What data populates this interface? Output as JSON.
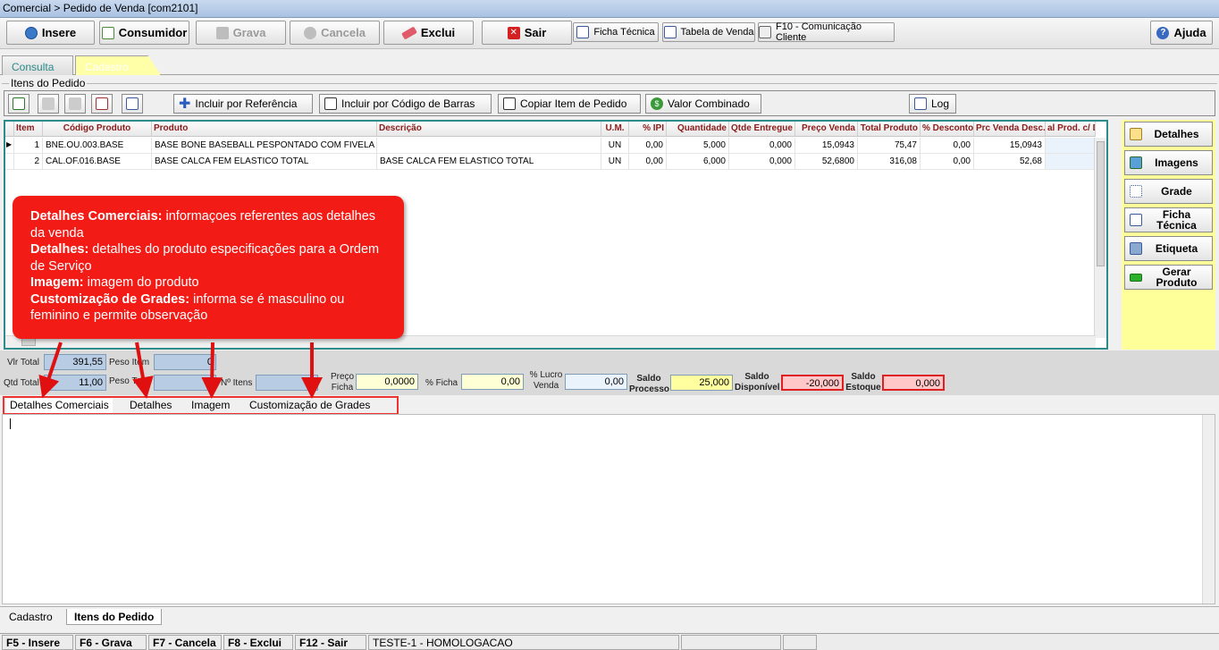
{
  "window": {
    "title": "Comercial > Pedido de Venda [com2101]"
  },
  "toolbar": {
    "insere": "Insere",
    "consumidor": "Consumidor",
    "grava": "Grava",
    "cancela": "Cancela",
    "exclui": "Exclui",
    "sair": "Sair",
    "ficha_tecnica": "Ficha Técnica",
    "tabela_venda": "Tabela de Venda",
    "comunicacao": "F10 - Comunicação Cliente",
    "ajuda": "Ajuda"
  },
  "main_tabs": {
    "consulta": "Consulta",
    "cadastro": "Cadastro"
  },
  "group": {
    "title": "Itens do Pedido"
  },
  "item_toolbar": {
    "incluir_ref": "Incluir por Referência",
    "incluir_barras": "Incluir por Código de Barras",
    "copiar": "Copiar Item de Pedido",
    "valor_combinado": "Valor Combinado",
    "log": "Log"
  },
  "grid": {
    "headers": [
      "Item",
      "Código Produto",
      "Produto",
      "Descrição",
      "U.M.",
      "% IPI",
      "Quantidade",
      "Qtde Entregue",
      "Preço Venda",
      "Total Produto",
      "% Desconto",
      "Prc Venda Desc.",
      "al Prod. c/ D"
    ],
    "rows": [
      {
        "item": "1",
        "codigo": "BNE.OU.003.BASE",
        "produto": "BASE BONE BASEBALL PESPONTADO COM FIVELA METALI",
        "descricao": "",
        "um": "UN",
        "ipi": "0,00",
        "quantidade": "5,000",
        "entregue": "0,000",
        "preco": "15,0943",
        "total": "75,47",
        "desconto": "0,00",
        "prc_desc": "15,0943"
      },
      {
        "item": "2",
        "codigo": "CAL.OF.016.BASE",
        "produto": "BASE CALCA FEM ELASTICO TOTAL",
        "descricao": "BASE CALCA FEM ELASTICO TOTAL",
        "um": "UN",
        "ipi": "0,00",
        "quantidade": "6,000",
        "entregue": "0,000",
        "preco": "52,6800",
        "total": "316,08",
        "desconto": "0,00",
        "prc_desc": "52,68"
      }
    ]
  },
  "side_buttons": {
    "detalhes": "Detalhes",
    "imagens": "Imagens",
    "grade": "Grade",
    "ficha_tecnica": "Ficha Técnica",
    "etiqueta": "Etiqueta",
    "gerar_produto": "Gerar Produto"
  },
  "totals": {
    "vlr_total_label": "Vlr Total",
    "vlr_total": "391,55",
    "qtd_total_label": "Qtd Total",
    "qtd_total": "11,00",
    "peso_item_label": "Peso Item",
    "peso_item": "0",
    "peso_total_label": "Peso Total",
    "peso_total": "",
    "n_itens_label": "Nº Itens",
    "n_itens": "",
    "preco_ficha_label": "Preço Ficha",
    "preco_ficha": "0,0000",
    "pct_ficha_label": "% Ficha",
    "pct_ficha": "0,00",
    "pct_lucro_label": "% Lucro Venda",
    "pct_lucro": "0,00",
    "saldo_processo_label": "Saldo Processo",
    "saldo_processo": "25,000",
    "saldo_disponivel_label": "Saldo Disponível",
    "saldo_disponivel": "-20,000",
    "saldo_estoque_label": "Saldo Estoque",
    "saldo_estoque": "0,000"
  },
  "detail_tabs": [
    "Detalhes Comerciais",
    "Detalhes",
    "Imagem",
    "Customização de Grades"
  ],
  "bottom_tabs": {
    "cadastro": "Cadastro",
    "itens": "Itens do Pedido"
  },
  "status": {
    "f5": "F5 - Insere",
    "f6": "F6 - Grava",
    "f7": "F7 - Cancela",
    "f8": "F8 - Exclui",
    "f12": "F12 - Sair",
    "env": "TESTE-1 - HOMOLOGACAO"
  },
  "callout": {
    "l1_bold": "Detalhes Comerciais:",
    "l1_text": " informaçoes referentes aos detalhes da venda",
    "l2_bold": "Detalhes:",
    "l2_text": " detalhes do produto especificações para a Ordem de Serviço",
    "l3_bold": "Imagem:",
    "l3_text": " imagem do produto",
    "l4_bold": "Customização de Grades:",
    "l4_text": " informa se é masculino ou feminino e permite observação"
  },
  "colors": {
    "callout": "#f21b16",
    "grid_border": "#2e8b8b",
    "side_panel": "#ffff99",
    "header_text": "#8b1a1a"
  }
}
